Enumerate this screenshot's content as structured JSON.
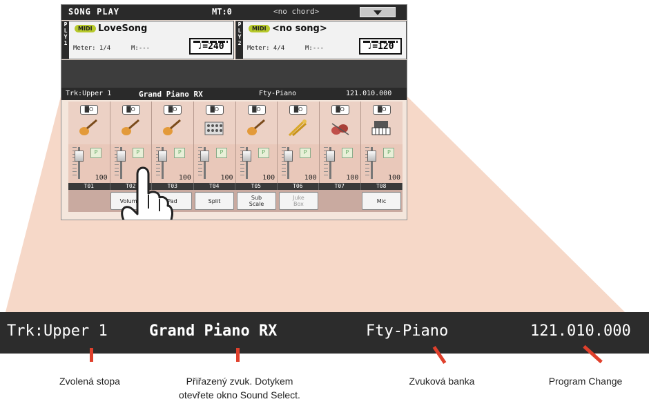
{
  "screen": {
    "header": {
      "title": "SONG PLAY",
      "master_transpose": "MT:0",
      "chord": "<no chord>"
    },
    "players": [
      {
        "side_label": "PLY1",
        "midi_badge": "MIDI",
        "song": "LoveSong",
        "meter": "Meter: 1/4",
        "measure": "M:---",
        "tempo": "♩=240"
      },
      {
        "side_label": "PLY2",
        "midi_badge": "MIDI",
        "song": "<no song>",
        "meter": "Meter: 4/4",
        "measure": "M:---",
        "tempo": "♩=120"
      }
    ],
    "infobar": {
      "track": "Trk:Upper 1",
      "sound": "Grand Piano RX",
      "bank": "Fty-Piano",
      "program": "121.010.000"
    },
    "tracks": [
      {
        "id": "T01",
        "instrument": "guitar-icon",
        "volume": "100"
      },
      {
        "id": "T02",
        "instrument": "guitar-icon",
        "volume": "100"
      },
      {
        "id": "T03",
        "instrument": "guitar-icon",
        "volume": "100"
      },
      {
        "id": "T04",
        "instrument": "drumkit-icon",
        "volume": "100"
      },
      {
        "id": "T05",
        "instrument": "guitar-icon",
        "volume": "100"
      },
      {
        "id": "T06",
        "instrument": "brass-icon",
        "volume": "100"
      },
      {
        "id": "T07",
        "instrument": "strings-icon",
        "volume": "100"
      },
      {
        "id": "T08",
        "instrument": "keyboard-icon",
        "volume": "100"
      }
    ],
    "mute_label": "█O",
    "play_label": "P",
    "buttons": [
      "",
      "Volume",
      "Pad",
      "Split",
      "Sub\nScale",
      "Juke\nBox",
      "",
      "Mic"
    ]
  },
  "zoom": {
    "track": "Trk:Upper 1",
    "sound": "Grand Piano RX",
    "bank": "Fty-Piano",
    "program": "121.010.000"
  },
  "captions": {
    "track": "Zvolená stopa",
    "sound_line1": "Přiřazený zvuk. Dotykem",
    "sound_line2": "otevřete okno Sound Select.",
    "bank": "Zvuková banka",
    "program": "Program Change"
  },
  "colors": {
    "zoom_fill": "#f6d8c8",
    "marker": "#e0402c"
  }
}
